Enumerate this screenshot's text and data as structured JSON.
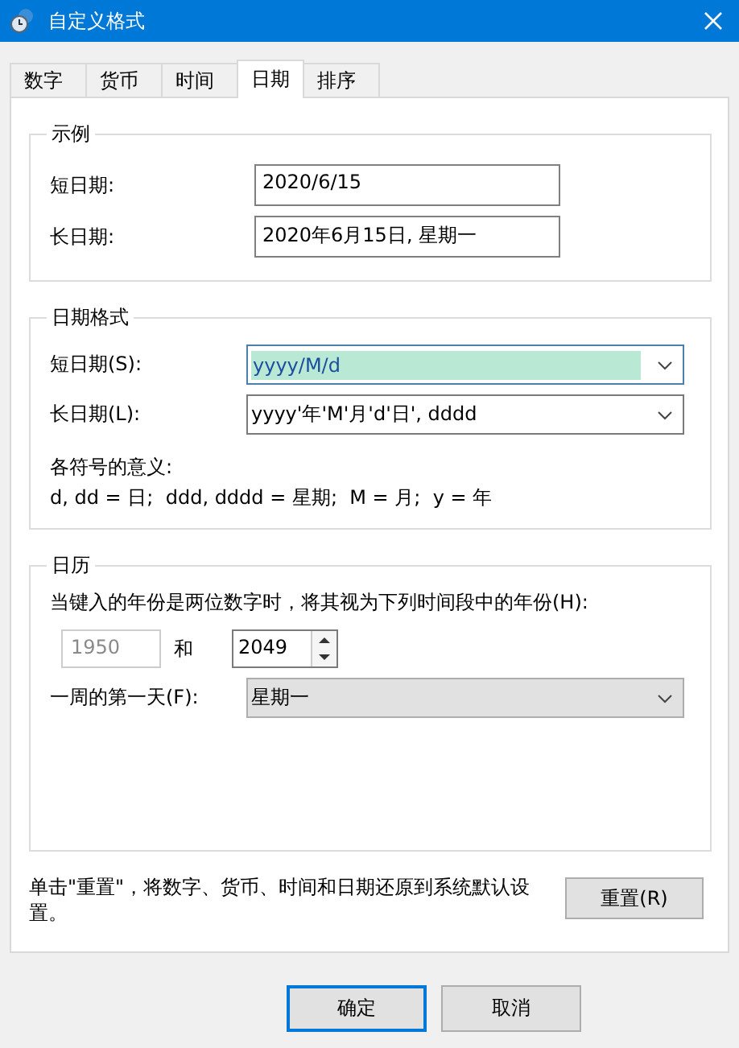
{
  "window": {
    "title": "自定义格式"
  },
  "tabs": [
    {
      "label": "数字",
      "selected": false
    },
    {
      "label": "货币",
      "selected": false
    },
    {
      "label": "时间",
      "selected": false
    },
    {
      "label": "日期",
      "selected": true
    },
    {
      "label": "排序",
      "selected": false
    }
  ],
  "example": {
    "title": "示例",
    "rows": [
      {
        "label": "短日期:",
        "value": "2020/6/15"
      },
      {
        "label": "长日期:",
        "value": "2020年6月15日, 星期一"
      }
    ]
  },
  "date_formats": {
    "title": "日期格式",
    "rows": [
      {
        "label": "短日期(S):",
        "value": "yyyy/M/d",
        "selected": true
      },
      {
        "label": "长日期(L):",
        "value": "yyyy'年'M'月'd'日', dddd",
        "selected": false
      }
    ],
    "legend_title": "各符号的意义:",
    "legend": "d, dd = 日;  ddd, dddd = 星期;  M = 月;  y = 年"
  },
  "calendar": {
    "title": "日历",
    "prompt": "当键入的年份是两位数字时，将其视为下列时间段中的年份(H):",
    "year_from": {
      "value": "1950",
      "disabled": true
    },
    "and_label": "和",
    "year_to": {
      "value": "2049",
      "disabled": false
    },
    "first_day_label": "一周的第一天(F):",
    "first_day": "星期一"
  },
  "reset": {
    "text": "单击\"重置\"，将数字、货币、时间和日期还原到系统默认设置。",
    "button": "重置(R)"
  },
  "buttons": [
    {
      "label": "确定",
      "default": true
    },
    {
      "label": "取消",
      "default": false
    }
  ]
}
